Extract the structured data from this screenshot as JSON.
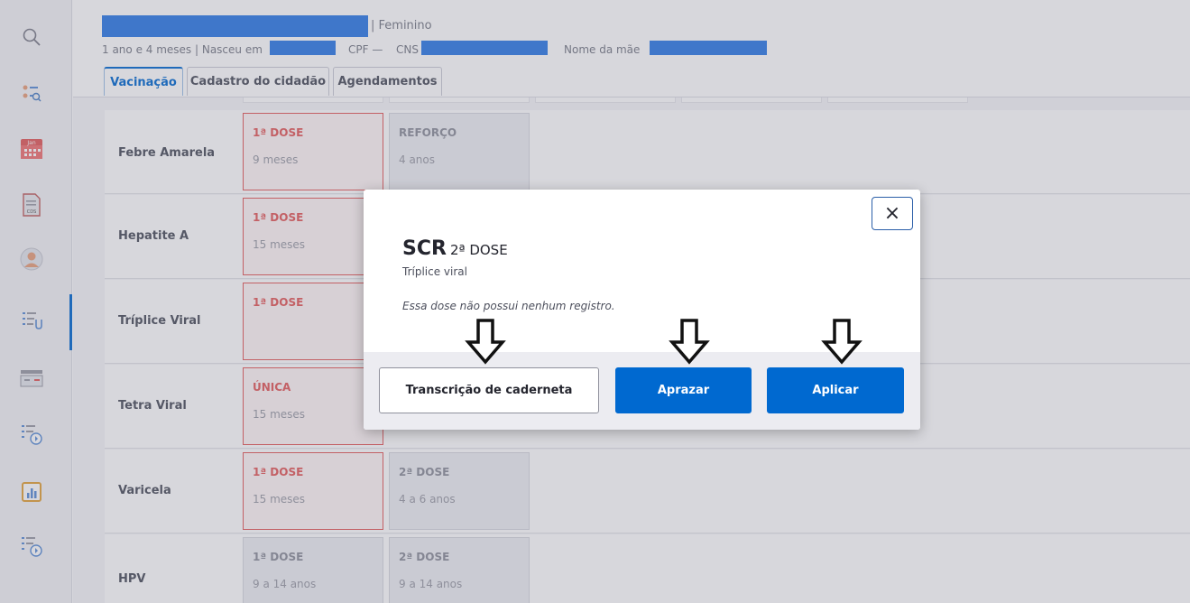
{
  "header": {
    "gender": "| Feminino",
    "age_birth": "1 ano e 4 meses | Nasceu em",
    "cpf_label": "CPF —",
    "cns_label": "CNS",
    "mother_label": "Nome da mãe",
    "tabs": [
      {
        "label": "Vacinação",
        "active": true
      },
      {
        "label": "Cadastro do cidadão",
        "active": false
      },
      {
        "label": "Agendamentos",
        "active": false
      }
    ]
  },
  "sidebar": {
    "icons": [
      "search-icon",
      "person-search-icon",
      "calendar-icon",
      "cds-document-icon",
      "user-avatar-icon",
      "vaccine-list-icon",
      "queue-icon",
      "list-clock-icon",
      "report-chart-icon",
      "list-clock-2-icon"
    ],
    "calendar_label": "Jan",
    "cds_label": "CDS"
  },
  "vaccines": [
    {
      "name": "Febre Amarela",
      "doses": [
        {
          "label": "1ª DOSE",
          "age": "9 meses",
          "style": "red"
        },
        {
          "label": "REFORÇO",
          "age": "4 anos",
          "style": "gray"
        }
      ]
    },
    {
      "name": "Hepatite A",
      "doses": [
        {
          "label": "1ª DOSE",
          "age": "15 meses",
          "style": "red"
        }
      ]
    },
    {
      "name": "Tríplice Viral",
      "doses": [
        {
          "label": "1ª DOSE",
          "age": "",
          "style": "red"
        }
      ]
    },
    {
      "name": "Tetra Viral",
      "doses": [
        {
          "label": "ÚNICA",
          "age": "15 meses",
          "style": "red"
        }
      ]
    },
    {
      "name": "Varicela",
      "doses": [
        {
          "label": "1ª DOSE",
          "age": "15 meses",
          "style": "red"
        },
        {
          "label": "2ª DOSE",
          "age": "4 a 6 anos",
          "style": "gray"
        }
      ]
    },
    {
      "name": "HPV",
      "doses": [
        {
          "label": "1ª DOSE",
          "age": "9 a 14 anos",
          "style": "gray"
        },
        {
          "label": "2ª DOSE",
          "age": "9 a 14 anos",
          "style": "gray"
        }
      ]
    }
  ],
  "modal": {
    "title": "SCR",
    "dose": "2ª DOSE",
    "subtitle": "Tríplice viral",
    "message": "Essa dose não possui nenhum registro.",
    "close_label": "×",
    "buttons": {
      "transcription": "Transcrição de caderneta",
      "schedule": "Aprazar",
      "apply": "Aplicar"
    }
  },
  "colors": {
    "primary": "#0069d0",
    "danger": "#e35b5b",
    "redaction": "#2d7be6"
  }
}
